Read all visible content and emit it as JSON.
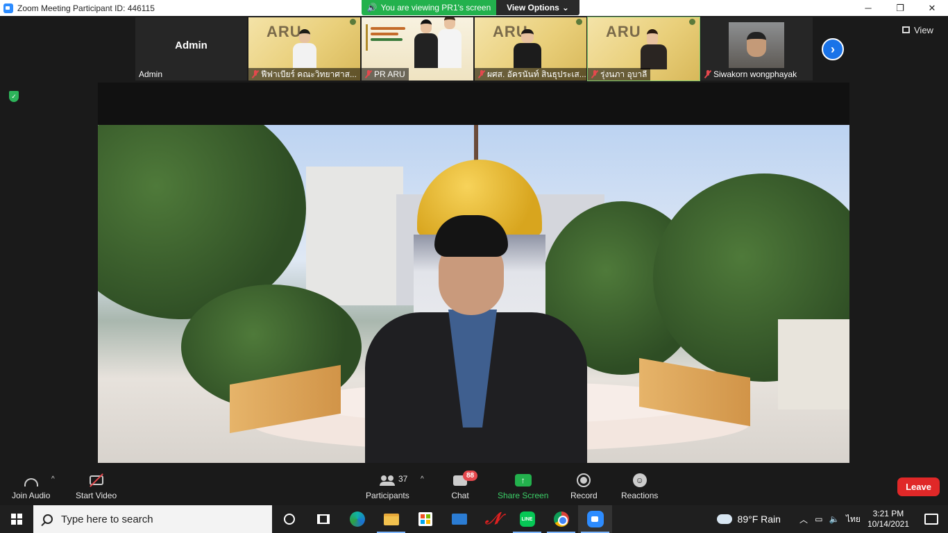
{
  "window": {
    "title": "Zoom Meeting Participant ID: 446115",
    "minimize": "─",
    "restore": "❐",
    "close": "✕"
  },
  "banner": {
    "viewing_text": "You are viewing PR1's screen",
    "view_options": "View Options"
  },
  "gallery": {
    "view_label": "View",
    "participants": [
      {
        "name": "Admin",
        "center_label": "Admin",
        "muted": false,
        "type": "plain"
      },
      {
        "name": "ฟีฟาเบียร์ คณะวิทยาศาส...",
        "muted": true,
        "type": "aru"
      },
      {
        "name": "PR ARU",
        "muted": true,
        "type": "pr"
      },
      {
        "name": "ผศส. อัครนันท์ สินธุประเส...",
        "muted": true,
        "type": "aru"
      },
      {
        "name": "รุ่งนภา อุบาลี",
        "muted": true,
        "type": "aru",
        "active": true
      },
      {
        "name": "Siwakorn wongphayak",
        "muted": true,
        "type": "photo"
      }
    ],
    "slide_logo_text": "ARU"
  },
  "toolbar": {
    "join_audio": "Join Audio",
    "start_video": "Start Video",
    "participants_label": "Participants",
    "participants_count": "37",
    "chat_label": "Chat",
    "chat_badge": "88",
    "share_screen": "Share Screen",
    "record": "Record",
    "reactions": "Reactions",
    "leave": "Leave"
  },
  "taskbar": {
    "search_placeholder": "Type here to search",
    "weather": "89°F  Rain",
    "language": "ไทย",
    "time": "3:21 PM",
    "date": "10/14/2021",
    "line_label": "LINE"
  }
}
